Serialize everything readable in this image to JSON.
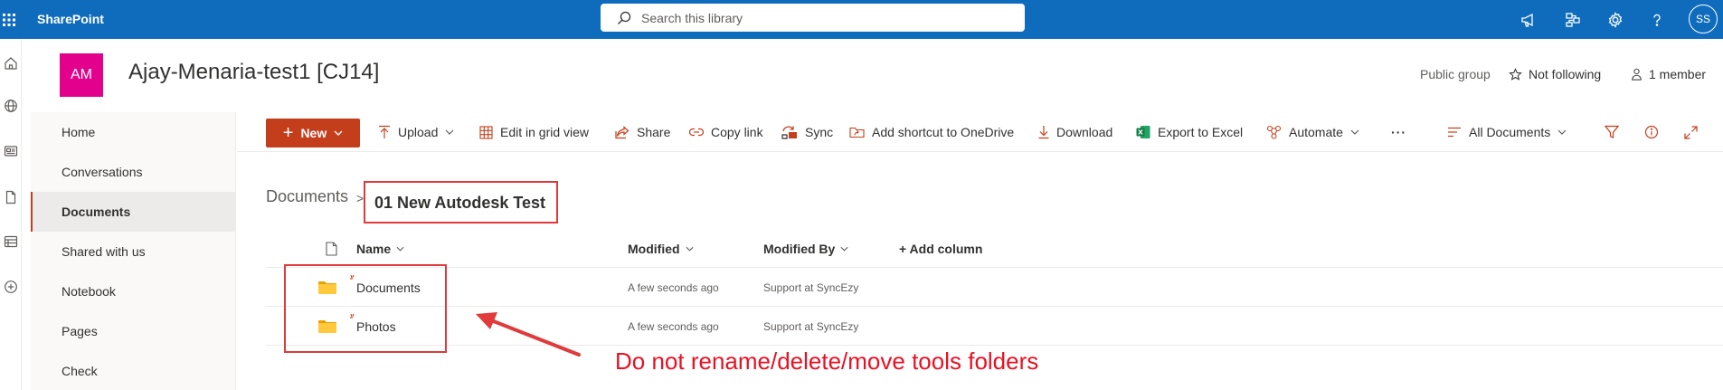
{
  "suite_bar": {
    "app_name": "SharePoint",
    "search_placeholder": "Search this library",
    "avatar_initials": "SS",
    "colors": {
      "bar": "#0f6cbd",
      "text": "#ffffff"
    },
    "icons": [
      "waffle-icon",
      "megaphone-icon",
      "flow-icon",
      "gear-icon",
      "help-icon"
    ]
  },
  "rail_icons": [
    "home-icon",
    "globe-icon",
    "news-icon",
    "file-icon",
    "list-icon",
    "add-circle-icon"
  ],
  "site": {
    "logo_initials": "AM",
    "logo_color": "#e3008c",
    "title": "Ajay-Menaria-test1 [CJ14]",
    "visibility": "Public group",
    "follow_label": "Not following",
    "members_label": "1 member"
  },
  "left_nav": {
    "items": [
      {
        "label": "Home",
        "selected": false
      },
      {
        "label": "Conversations",
        "selected": false
      },
      {
        "label": "Documents",
        "selected": true
      },
      {
        "label": "Shared with us",
        "selected": false
      },
      {
        "label": "Notebook",
        "selected": false
      },
      {
        "label": "Pages",
        "selected": false
      },
      {
        "label": "Check",
        "selected": false
      }
    ],
    "accent": "#c43e1c"
  },
  "command_bar": {
    "new_label": "New",
    "upload_label": "Upload",
    "grid_view_label": "Edit in grid view",
    "share_label": "Share",
    "copy_link_label": "Copy link",
    "sync_label": "Sync",
    "shortcut_label": "Add shortcut to OneDrive",
    "download_label": "Download",
    "export_label": "Export to Excel",
    "automate_label": "Automate",
    "more_label": "···",
    "view_label": "All Documents",
    "primary_color": "#c43e1c"
  },
  "breadcrumb": {
    "root": "Documents",
    "separator": ">",
    "current": "01 New Autodesk Test"
  },
  "list": {
    "columns": {
      "name": "Name",
      "modified": "Modified",
      "modified_by": "Modified By",
      "add_column": "+ Add column"
    },
    "rows": [
      {
        "name": "Documents",
        "modified": "A few seconds ago",
        "modified_by": "Support at SyncEzy",
        "icon": "folder-icon"
      },
      {
        "name": "Photos",
        "modified": "A few seconds ago",
        "modified_by": "Support at SyncEzy",
        "icon": "folder-icon"
      }
    ]
  },
  "annotation": {
    "text": "Do not rename/delete/move tools folders",
    "color": "#e81123"
  }
}
